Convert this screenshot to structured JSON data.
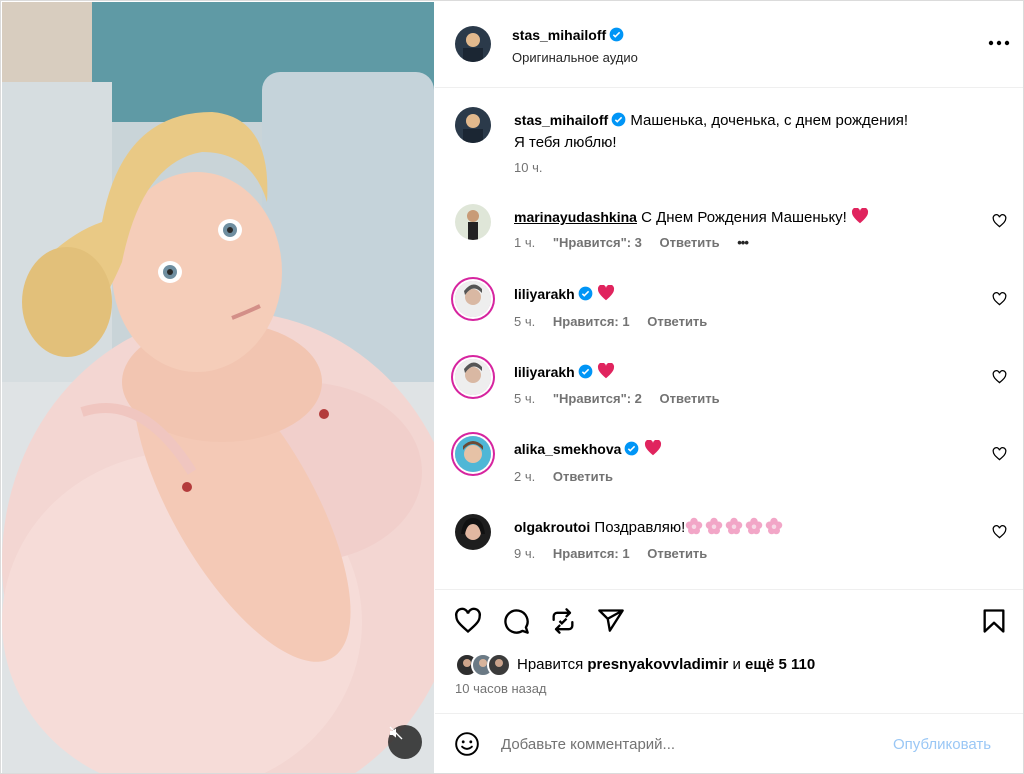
{
  "post": {
    "author": "stas_mihailoff",
    "audio": "Оригинальное аудио",
    "caption_author": "stas_mihailoff",
    "caption_line1": "Машенька, доченька, с днем рождения!",
    "caption_line2": "Я тебя люблю!",
    "caption_time": "10 ч."
  },
  "comments": [
    {
      "user": "marinayudashkina",
      "text": "С Днем Рождения Машеньку!",
      "time": "1 ч.",
      "likes": "\"Нравится\": 3",
      "reply": "Ответить",
      "more": "•••"
    },
    {
      "user": "liliyarakh",
      "text": "",
      "time": "5 ч.",
      "likes": "Нравится: 1",
      "reply": "Ответить"
    },
    {
      "user": "liliyarakh",
      "text": "",
      "time": "5 ч.",
      "likes": "\"Нравится\": 2",
      "reply": "Ответить"
    },
    {
      "user": "alika_smekhova",
      "text": "",
      "time": "2 ч.",
      "likes": "",
      "reply": "Ответить"
    },
    {
      "user": "olgakroutoi",
      "text": "Поздравляю!",
      "time": "9 ч.",
      "likes": "Нравится: 1",
      "reply": "Ответить"
    }
  ],
  "likes": {
    "prefix": "Нравится",
    "user": "presnyakovvladimir",
    "joiner": "и",
    "rest": "ещё 5 110"
  },
  "time_ago": "10 часов назад",
  "comment_box": {
    "placeholder": "Добавьте комментарий...",
    "publish": "Опубликовать"
  },
  "colors": {
    "verified": "#0095f6",
    "heart": "#e0245e",
    "publish_disabled": "#9ac7f5",
    "secondary_text": "#737373"
  },
  "icons": [
    "like-icon",
    "comment-icon",
    "repost-icon",
    "share-icon",
    "save-icon",
    "more-icon",
    "mute-icon",
    "emoji-icon",
    "verified-icon"
  ]
}
